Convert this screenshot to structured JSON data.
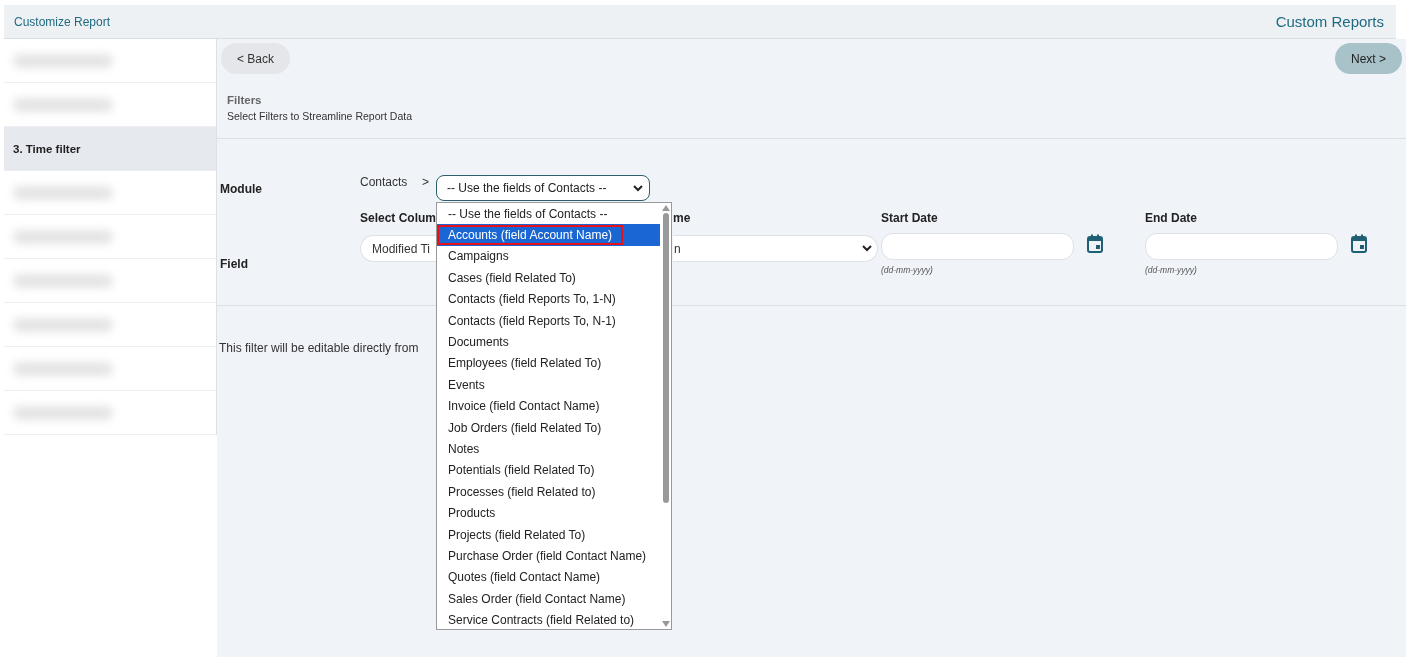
{
  "header": {
    "title": "Customize Report",
    "app_title": "Custom Reports"
  },
  "sidebar": {
    "items": [
      {
        "kind": "blurred",
        "selected": false
      },
      {
        "kind": "blurred",
        "selected": false
      },
      {
        "kind": "step",
        "label": "3. Time filter",
        "selected": true
      },
      {
        "kind": "blurred",
        "selected": false
      },
      {
        "kind": "blurred",
        "selected": false
      },
      {
        "kind": "blurred",
        "selected": false
      },
      {
        "kind": "blurred",
        "selected": false
      },
      {
        "kind": "blurred",
        "selected": false
      },
      {
        "kind": "blurred",
        "selected": false
      }
    ]
  },
  "nav": {
    "back": "< Back",
    "next": "Next >"
  },
  "section": {
    "title": "Filters",
    "subtitle": "Select Filters to Streamline Report Data"
  },
  "module": {
    "label": "Module",
    "path": "Contacts",
    "separator": ">",
    "value": "-- Use the fields of Contacts --"
  },
  "dropdown": {
    "options": [
      {
        "label": "-- Use the fields of Contacts --",
        "selected": false,
        "outlined": false
      },
      {
        "label": "Accounts (field Account Name)",
        "selected": true,
        "outlined": true
      },
      {
        "label": "Campaigns",
        "selected": false,
        "outlined": false
      },
      {
        "label": "Cases (field Related To)",
        "selected": false,
        "outlined": false
      },
      {
        "label": "Contacts (field Reports To, 1-N)",
        "selected": false,
        "outlined": false
      },
      {
        "label": "Contacts (field Reports To, N-1)",
        "selected": false,
        "outlined": false
      },
      {
        "label": "Documents",
        "selected": false,
        "outlined": false
      },
      {
        "label": "Employees (field Related To)",
        "selected": false,
        "outlined": false
      },
      {
        "label": "Events",
        "selected": false,
        "outlined": false
      },
      {
        "label": "Invoice (field Contact Name)",
        "selected": false,
        "outlined": false
      },
      {
        "label": "Job Orders (field Related To)",
        "selected": false,
        "outlined": false
      },
      {
        "label": "Notes",
        "selected": false,
        "outlined": false
      },
      {
        "label": "Potentials (field Related To)",
        "selected": false,
        "outlined": false
      },
      {
        "label": "Processes (field Related to)",
        "selected": false,
        "outlined": false
      },
      {
        "label": "Products",
        "selected": false,
        "outlined": false
      },
      {
        "label": "Projects (field Related To)",
        "selected": false,
        "outlined": false
      },
      {
        "label": "Purchase Order (field Contact Name)",
        "selected": false,
        "outlined": false
      },
      {
        "label": "Quotes (field Contact Name)",
        "selected": false,
        "outlined": false
      },
      {
        "label": "Sales Order (field Contact Name)",
        "selected": false,
        "outlined": false
      },
      {
        "label": "Service Contracts (field Related to)",
        "selected": false,
        "outlined": false
      }
    ]
  },
  "field": {
    "label": "Field",
    "column_heading": "Select Colum",
    "column_value": "Modified Ti",
    "column_2_heading": "me",
    "column_2_value": "n",
    "start_date": {
      "heading": "Start Date",
      "hint": "(dd-mm-yyyy)"
    },
    "end_date": {
      "heading": "End Date",
      "hint": "(dd-mm-yyyy)"
    }
  },
  "note": "This filter will be editable directly from"
}
